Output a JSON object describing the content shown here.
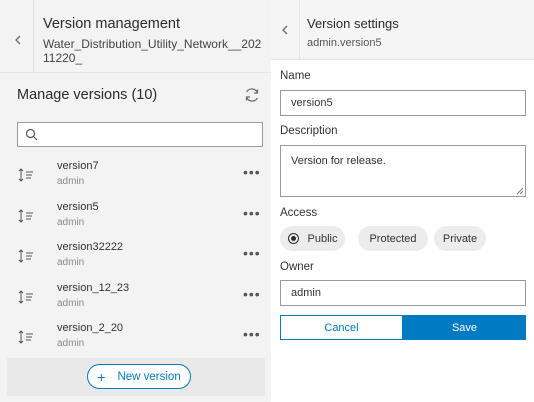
{
  "left_panel": {
    "header": {
      "title": "Version management",
      "subtitle": "Water_Distribution_Utility_Network__20211220_"
    },
    "manage_title": "Manage versions (10)",
    "search": {
      "value": "",
      "placeholder": ""
    },
    "versions": [
      {
        "name": "version7",
        "owner": "admin"
      },
      {
        "name": "version5",
        "owner": "admin"
      },
      {
        "name": "version32222",
        "owner": "admin"
      },
      {
        "name": "version_12_23",
        "owner": "admin"
      },
      {
        "name": "version_2_20",
        "owner": "admin"
      }
    ],
    "more_label": "•••",
    "new_version_label": "New version",
    "new_version_plus": "+"
  },
  "right_panel": {
    "header": {
      "title": "Version settings",
      "subtitle": "admin.version5"
    },
    "name_label": "Name",
    "name_value": "version5",
    "description_label": "Description",
    "description_value": "Version for release.",
    "access_label": "Access",
    "access_options": [
      "Public",
      "Protected",
      "Private"
    ],
    "access_selected": "Public",
    "owner_label": "Owner",
    "owner_value": "admin",
    "cancel_label": "Cancel",
    "save_label": "Save"
  },
  "icons": {
    "back": "chevron-left-icon",
    "refresh": "refresh-icon",
    "search": "search-icon",
    "sort": "sort-icon",
    "more": "ellipsis-icon"
  },
  "colors": {
    "accent": "#007ac2",
    "panel_bg": "#f3f3f3"
  }
}
